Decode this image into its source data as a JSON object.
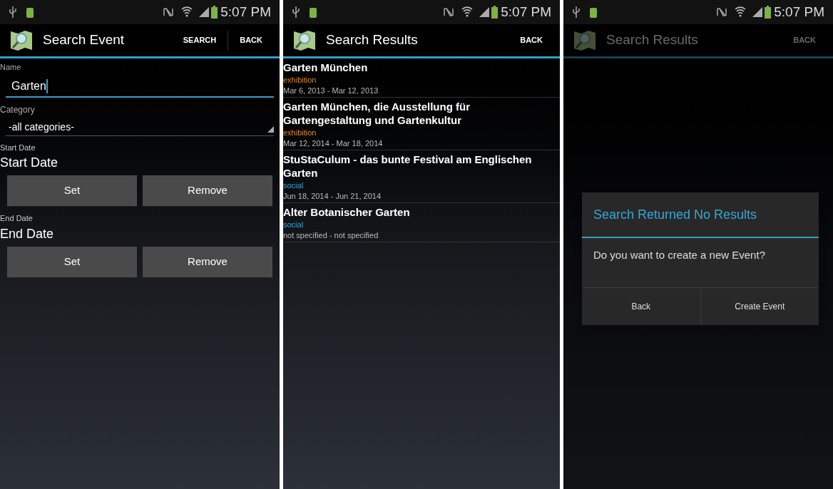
{
  "screens": [
    {
      "kind": "form",
      "dimmed": false,
      "status_bar": {
        "time": "5:07 PM"
      },
      "action_bar": {
        "title": "Search Event",
        "actions": [
          "SEARCH",
          "BACK"
        ]
      },
      "name_field": {
        "label": "Name",
        "value": "Garten"
      },
      "category": {
        "label": "Category",
        "value": "-all categories-"
      },
      "dates": [
        {
          "label": "Start Date",
          "value": "Start Date",
          "buttons": [
            "Set",
            "Remove"
          ]
        },
        {
          "label": "End Date",
          "value": "End Date",
          "buttons": [
            "Set",
            "Remove"
          ]
        }
      ]
    },
    {
      "kind": "results",
      "dimmed": false,
      "status_bar": {
        "time": "5:07 PM"
      },
      "action_bar": {
        "title": "Search Results",
        "actions": [
          "BACK"
        ]
      },
      "results": [
        {
          "title": "Garten München",
          "category": "exhibition",
          "color": "#e0891c",
          "dates": "Mar 6, 2013 - Mar 12, 2013"
        },
        {
          "title": "Garten München, die Ausstellung für Gartengestaltung und Gartenkultur",
          "category": "exhibition",
          "color": "#e0891c",
          "dates": "Mar 12, 2014 - Mar 18, 2014"
        },
        {
          "title": "StuStaCulum - das bunte Festival am Englischen Garten",
          "category": "social",
          "color": "#2fa8d8",
          "dates": "Jun 18, 2014 - Jun 21, 2014"
        },
        {
          "title": "Alter Botanischer Garten",
          "category": "social",
          "color": "#2fa8d8",
          "dates": "not specified - not specified"
        }
      ]
    },
    {
      "kind": "dialog",
      "dimmed": true,
      "status_bar": {
        "time": "5:07 PM"
      },
      "action_bar": {
        "title": "Search Results",
        "actions": [
          "BACK"
        ]
      },
      "dialog": {
        "title": "Search Returned No Results",
        "message": "Do you want to create a new Event?",
        "buttons": [
          "Back",
          "Create Event"
        ]
      }
    }
  ]
}
